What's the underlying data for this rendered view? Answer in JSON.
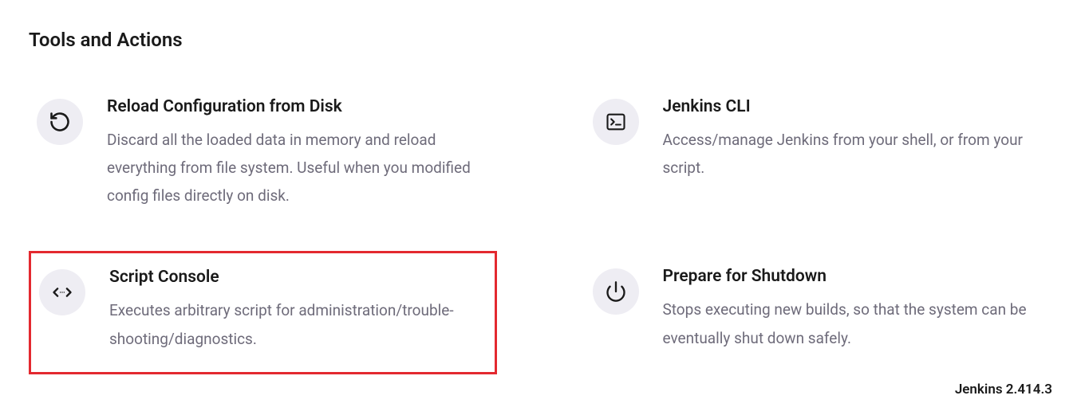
{
  "section": {
    "title": "Tools and Actions"
  },
  "cards": [
    {
      "title": "Reload Configuration from Disk",
      "desc": "Discard all the loaded data in memory and reload everything from file system. Useful when you modified config files directly on disk."
    },
    {
      "title": "Jenkins CLI",
      "desc": "Access/manage Jenkins from your shell, or from your script."
    },
    {
      "title": "Script Console",
      "desc": "Executes arbitrary script for administration/trouble-shooting/diagnostics."
    },
    {
      "title": "Prepare for Shutdown",
      "desc": "Stops executing new builds, so that the system can be eventually shut down safely."
    }
  ],
  "footer": {
    "version": "Jenkins 2.414.3"
  }
}
